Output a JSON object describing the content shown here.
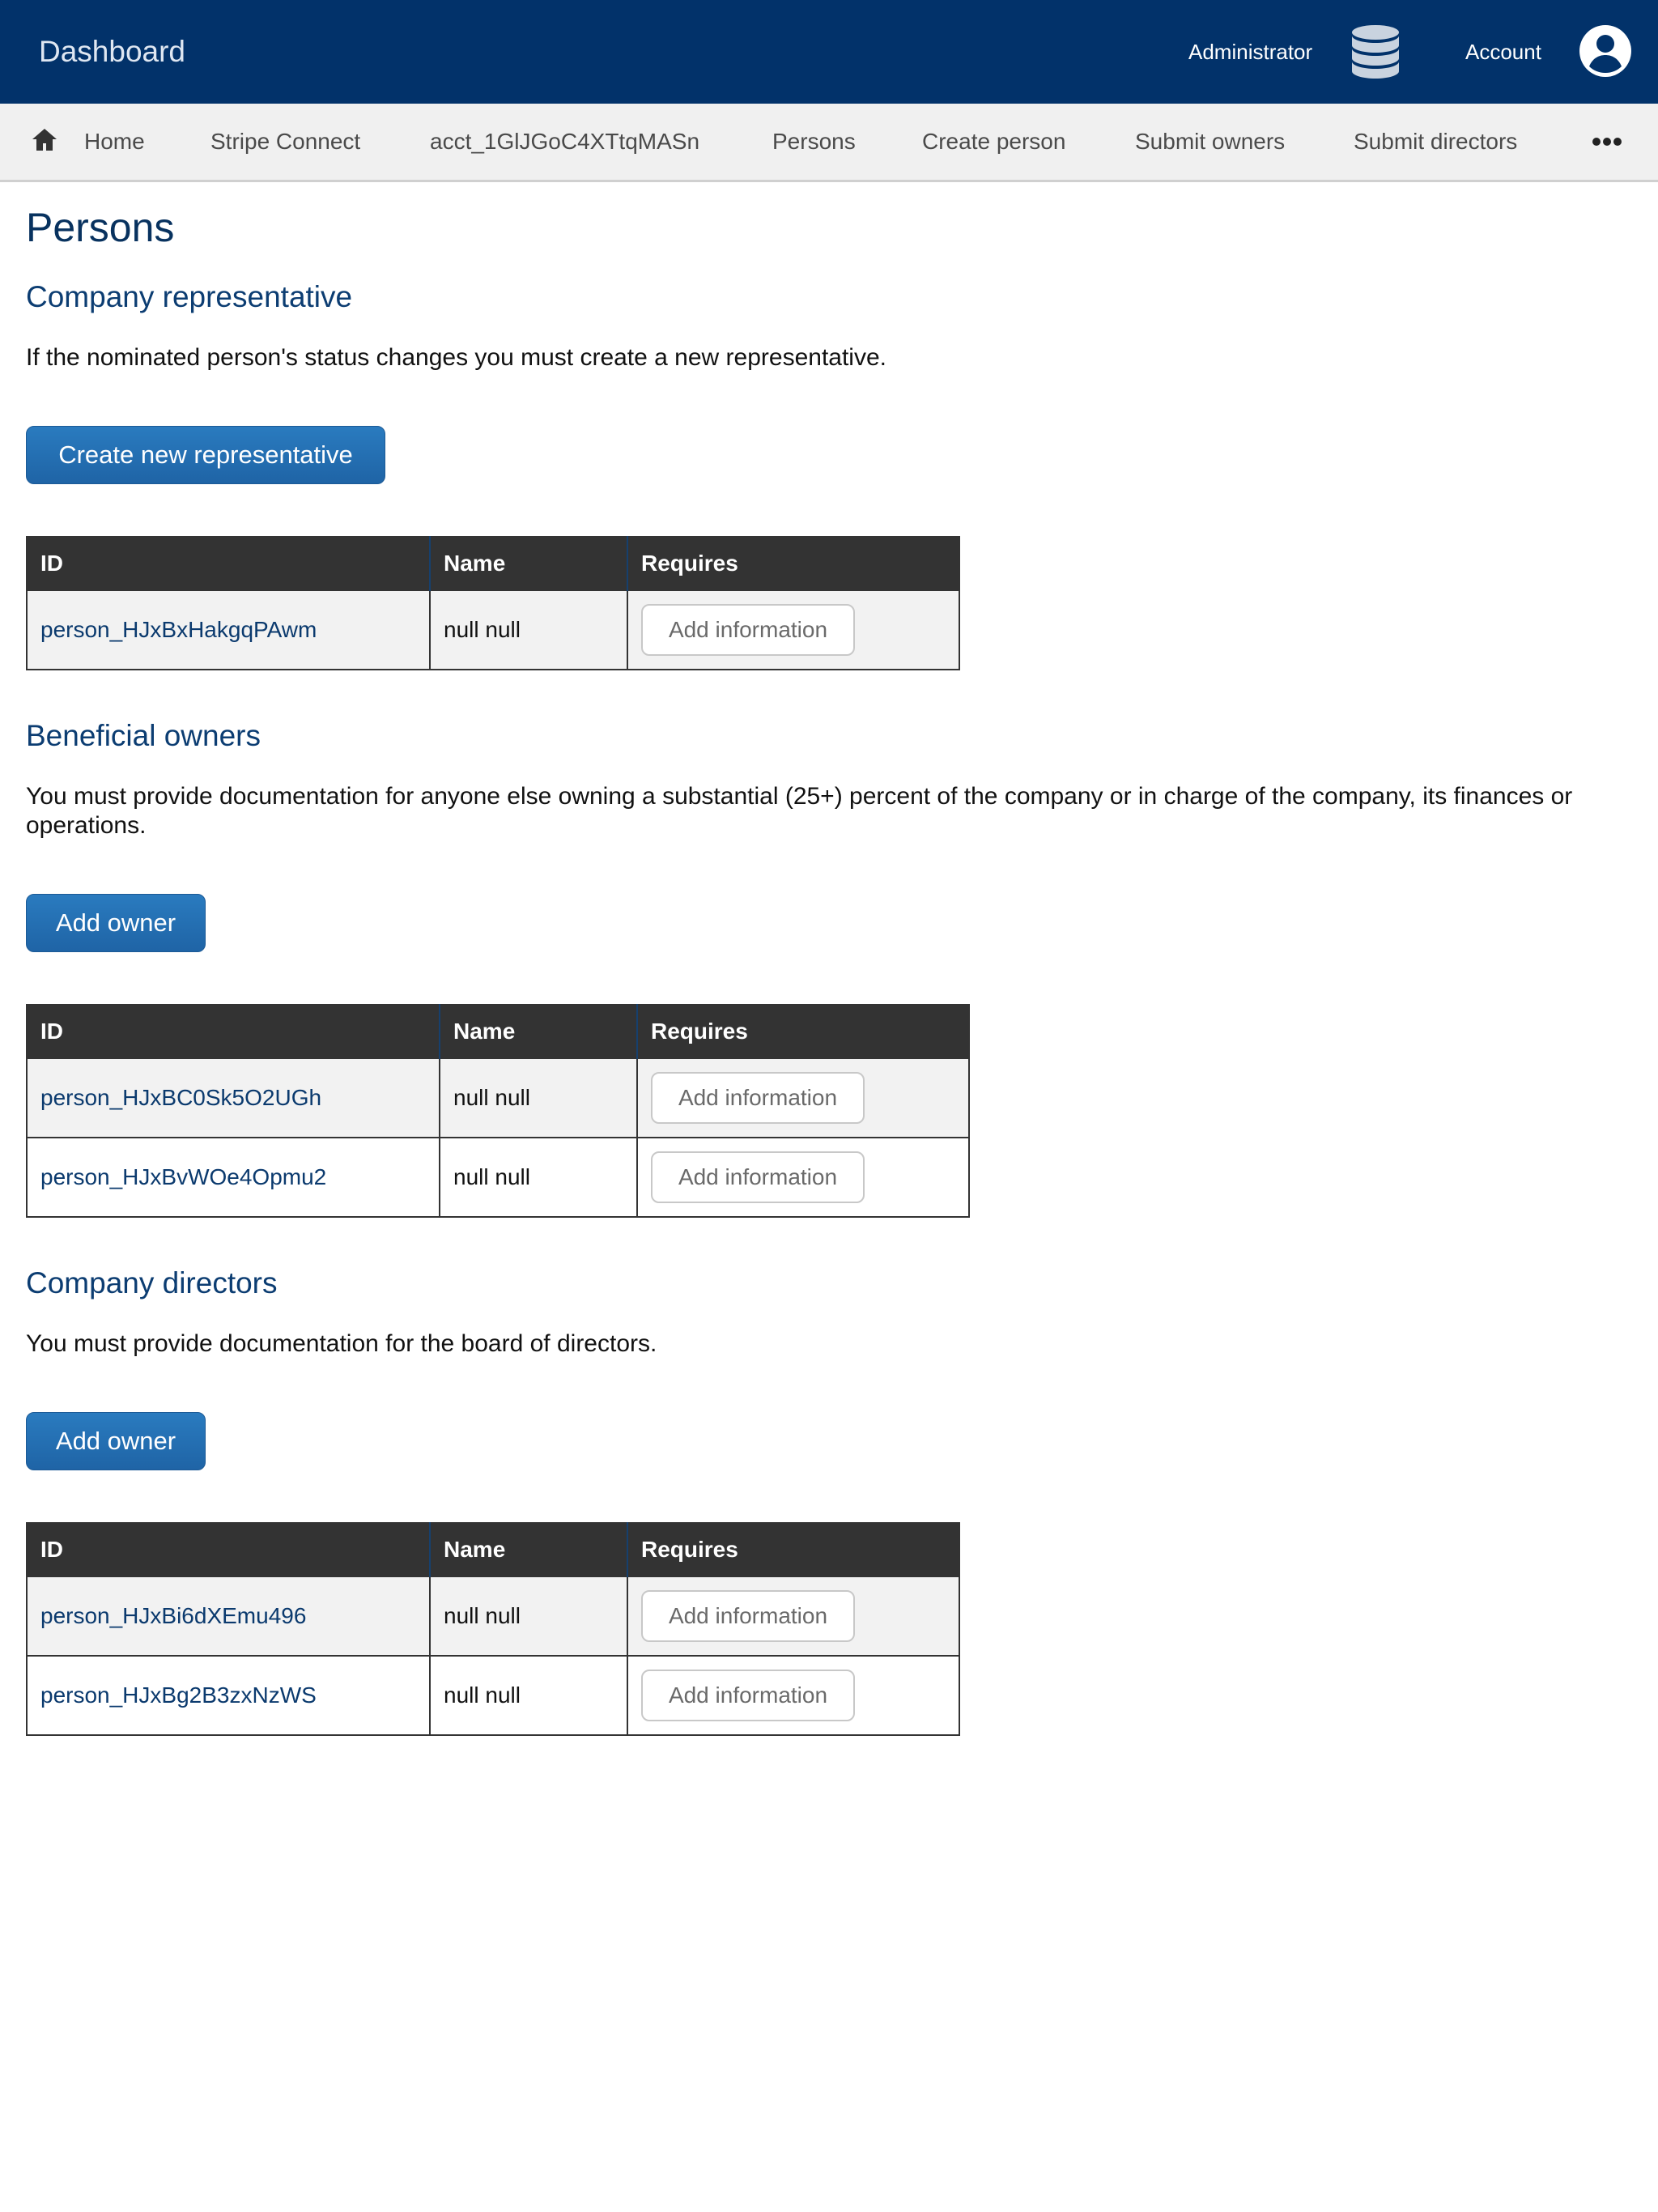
{
  "header": {
    "brand": "Dashboard",
    "admin_label": "Administrator",
    "account_label": "Account",
    "db_icon": "database-icon",
    "account_icon": "account-circle-icon"
  },
  "breadcrumbs": {
    "home_icon": "home-icon",
    "items": [
      "Home",
      "Stripe Connect",
      "acct_1GlJGoC4XTtqMASn",
      "Persons",
      "Create person",
      "Submit owners",
      "Submit directors"
    ],
    "more_icon": "more-horizontal-icon"
  },
  "page": {
    "title": "Persons"
  },
  "representative": {
    "heading": "Company representative",
    "text": "If the nominated person's status changes you must create a new representative.",
    "button": "Create new representative",
    "columns": [
      "ID",
      "Name",
      "Requires"
    ],
    "rows": [
      {
        "id": "person_HJxBxHakgqPAwm",
        "name": "null null",
        "action": "Add information"
      }
    ]
  },
  "owners": {
    "heading": "Beneficial owners",
    "text": "You must provide documentation for anyone else owning a substantial (25+) percent of the company or in charge of the company, its finances or operations.",
    "button": "Add owner",
    "columns": [
      "ID",
      "Name",
      "Requires"
    ],
    "rows": [
      {
        "id": "person_HJxBC0Sk5O2UGh",
        "name": "null null",
        "action": "Add information"
      },
      {
        "id": "person_HJxBvWOe4Opmu2",
        "name": "null null",
        "action": "Add information"
      }
    ]
  },
  "directors": {
    "heading": "Company directors",
    "text": "You must provide documentation for the board of directors.",
    "button": "Add owner",
    "columns": [
      "ID",
      "Name",
      "Requires"
    ],
    "rows": [
      {
        "id": "person_HJxBi6dXEmu496",
        "name": "null null",
        "action": "Add information"
      },
      {
        "id": "person_HJxBg2B3zxNzWS",
        "name": "null null",
        "action": "Add information"
      }
    ]
  },
  "colors": {
    "header_bg": "#02326a",
    "primary_button": "#1f64a6",
    "table_header": "#333333"
  }
}
